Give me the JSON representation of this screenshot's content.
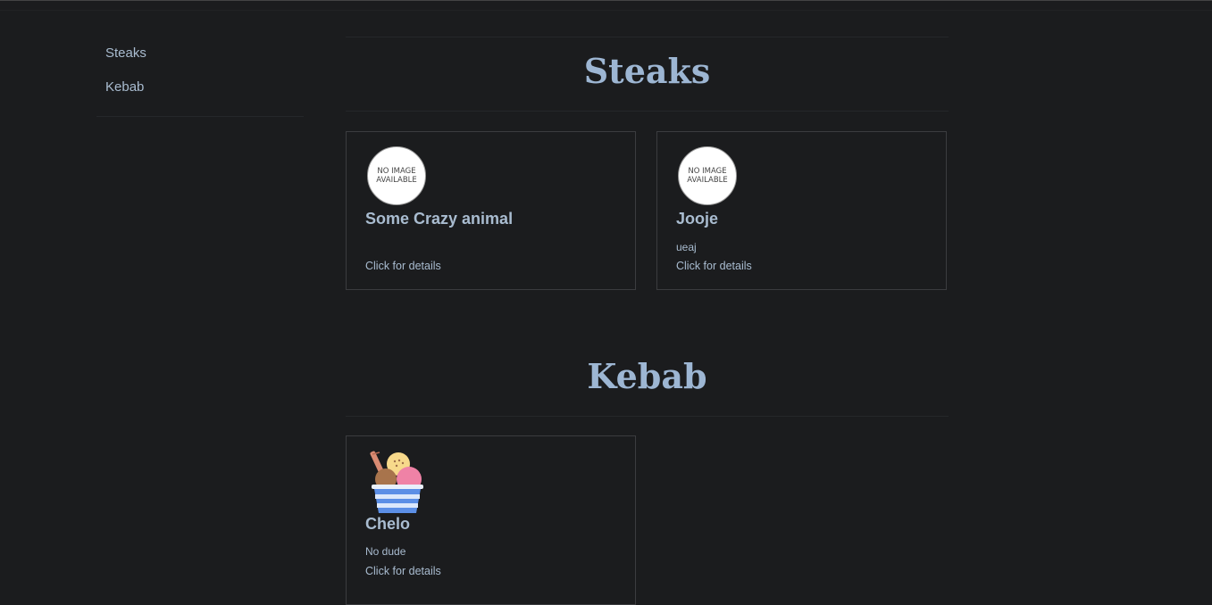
{
  "sidebar": {
    "items": [
      {
        "label": "Steaks"
      },
      {
        "label": "Kebab"
      }
    ]
  },
  "sections": [
    {
      "title": "Steaks",
      "items": [
        {
          "name": "Some Crazy animal",
          "description": "",
          "image": "NO IMAGE AVAILABLE",
          "link_label": "Click for details"
        },
        {
          "name": "Jooje",
          "description": "ueaj",
          "image": "NO IMAGE AVAILABLE",
          "link_label": "Click for details"
        }
      ]
    },
    {
      "title": "Kebab",
      "items": [
        {
          "name": "Chelo",
          "description": "No dude",
          "image_icon": "ice-cream-icon",
          "link_label": "Click for details"
        }
      ]
    }
  ],
  "no_image_text": {
    "line1": "NO IMAGE",
    "line2": "AVAILABLE"
  },
  "colors": {
    "background": "#1b1c1e",
    "accent": "#9db6d3",
    "text": "#a9bcd0"
  }
}
